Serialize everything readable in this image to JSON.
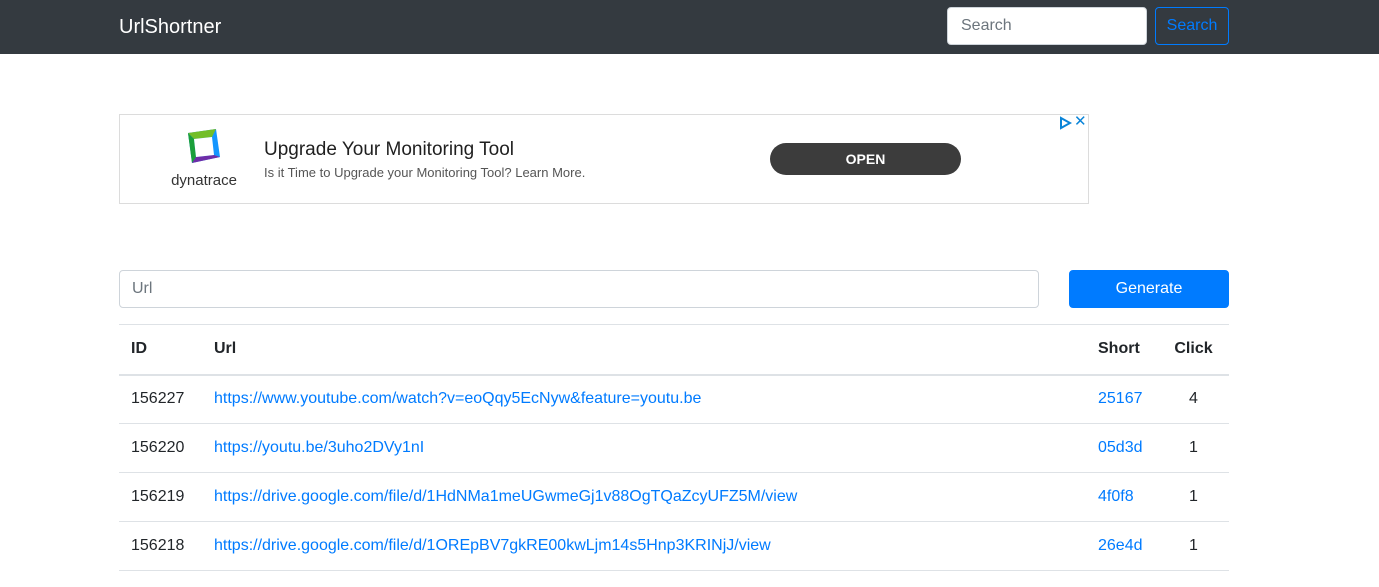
{
  "navbar": {
    "brand": "UrlShortner",
    "search_placeholder": "Search",
    "search_button": "Search"
  },
  "ad": {
    "logo_text": "dynatrace",
    "title": "Upgrade Your Monitoring Tool",
    "subtitle": "Is it Time to Upgrade your Monitoring Tool? Learn More.",
    "open_button": "OPEN",
    "close_symbol": "✕",
    "colors": {
      "logo_green": "#73be28",
      "logo_blue": "#1496ff",
      "logo_purple": "#6f2da8",
      "button_bg": "#3c3c3c",
      "choices_blue": "#0a84d8"
    }
  },
  "form": {
    "url_placeholder": "Url",
    "generate_button": "Generate"
  },
  "table": {
    "headers": {
      "id": "ID",
      "url": "Url",
      "short": "Short",
      "click": "Click"
    },
    "rows": [
      {
        "id": "156227",
        "url": "https://www.youtube.com/watch?v=eoQqy5EcNyw&feature=youtu.be",
        "short": "25167",
        "click": "4"
      },
      {
        "id": "156220",
        "url": "https://youtu.be/3uho2DVy1nI",
        "short": "05d3d",
        "click": "1"
      },
      {
        "id": "156219",
        "url": "https://drive.google.com/file/d/1HdNMa1meUGwmeGj1v88OgTQaZcyUFZ5M/view",
        "short": "4f0f8",
        "click": "1"
      },
      {
        "id": "156218",
        "url": "https://drive.google.com/file/d/1OREpBV7gkRE00kwLjm14s5Hnp3KRINjJ/view",
        "short": "26e4d",
        "click": "1"
      }
    ]
  },
  "colors": {
    "navbar_bg": "#343a40",
    "primary": "#007bff"
  }
}
